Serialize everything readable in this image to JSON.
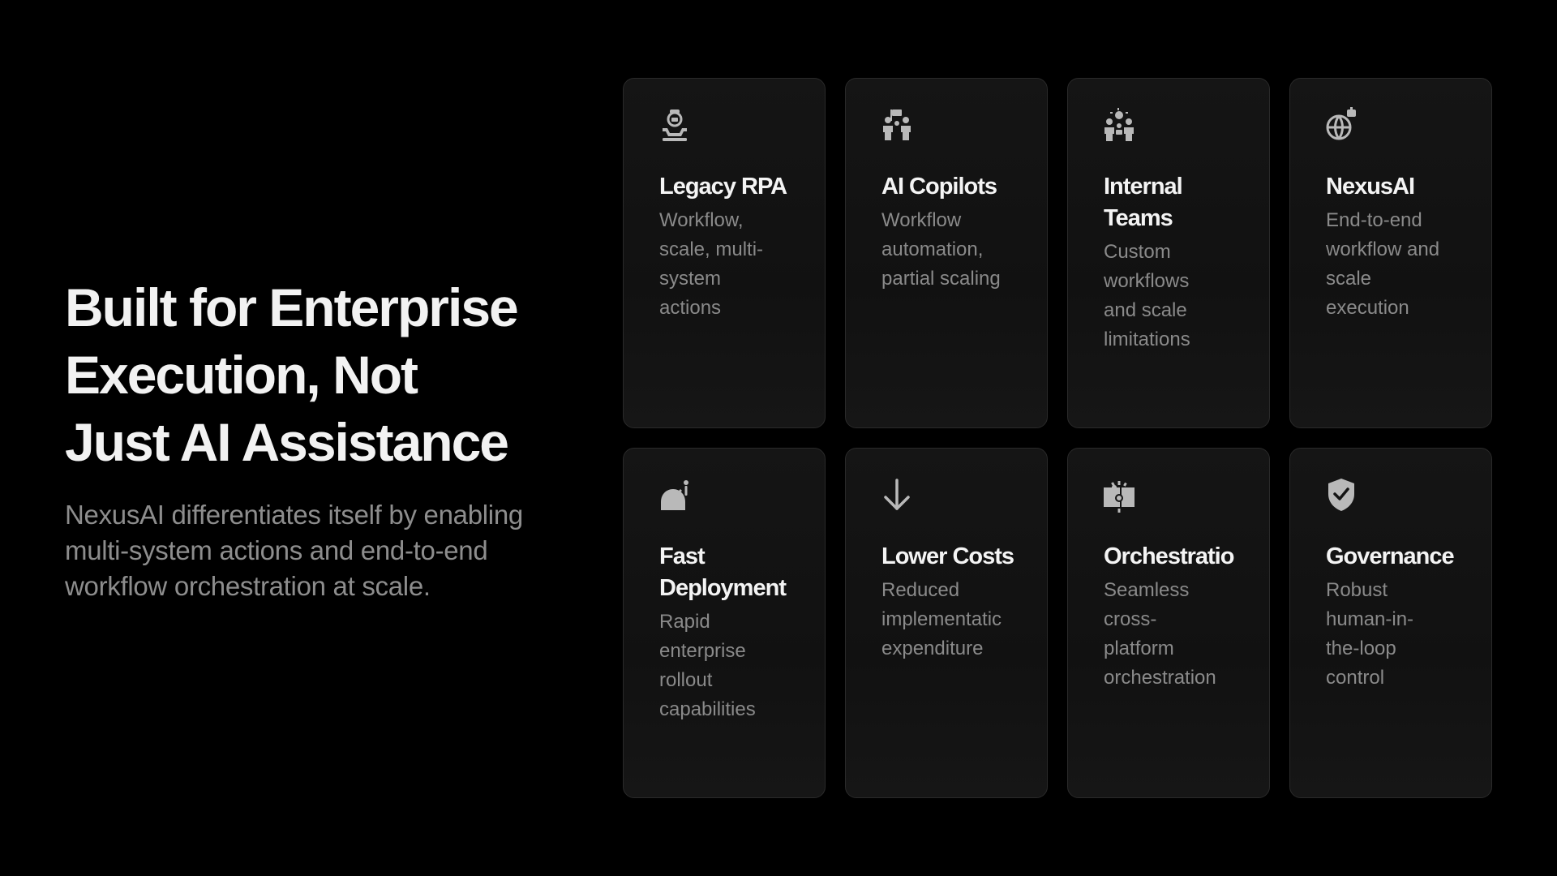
{
  "hero": {
    "title_lines": [
      "Built for Enterprise",
      "Execution, Not",
      "Just AI Assistance"
    ],
    "subtitle_lines": [
      "NexusAI differentiates itself by enabling",
      "multi-system actions and end-to-end",
      "workflow orchestration at scale."
    ]
  },
  "cards": [
    {
      "icon": "robot-arm-icon",
      "title": "Legacy RPA",
      "description": "Workflow,\nscale, multi-\nsystem\nactions"
    },
    {
      "icon": "team-flag-icon",
      "title": "AI Copilots",
      "description": "Workflow\nautomation,\npartial scaling"
    },
    {
      "icon": "team-idea-icon",
      "title": "Internal\nTeams",
      "description": "Custom\nworkflows\nand scale\nlimitations"
    },
    {
      "icon": "globe-ai-icon",
      "title": "NexusAI",
      "description": "End-to-end\nworkflow and\nscale\nexecution"
    },
    {
      "icon": "rocket-dome-icon",
      "title": "Fast\nDeployment",
      "description": "Rapid\nenterprise\nrollout\ncapabilities"
    },
    {
      "icon": "arrow-down-icon",
      "title": "Lower Costs",
      "description": "Reduced\nimplementatic\nexpenditure"
    },
    {
      "icon": "puzzle-gear-icon",
      "title": "Orchestratio",
      "description": "Seamless\ncross-\nplatform\norchestration"
    },
    {
      "icon": "shield-check-icon",
      "title": "Governance",
      "description": "Robust\nhuman-in-\nthe-loop\ncontrol"
    }
  ],
  "colors": {
    "background": "#000000",
    "card_border": "#2a2a2a",
    "title": "#f4f4f4",
    "muted": "#8a8a8a",
    "icon": "#b9b9b9"
  }
}
